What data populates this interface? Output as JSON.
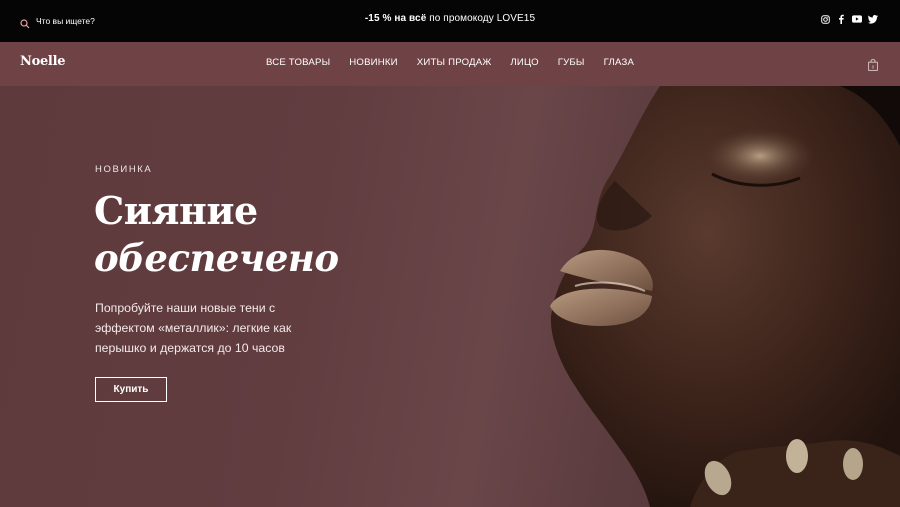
{
  "topbar": {
    "search_placeholder": "Что вы ищете?",
    "promo_bold": "-15 % на всё",
    "promo_rest": " по промокоду LOVE15",
    "social_icons": [
      "instagram-icon",
      "facebook-icon",
      "youtube-icon",
      "twitter-icon"
    ]
  },
  "navbar": {
    "logo": "Noelle",
    "menu": [
      "ВСЕ ТОВАРЫ",
      "НОВИНКИ",
      "ХИТЫ ПРОДАЖ",
      "ЛИЦО",
      "ГУБЫ",
      "ГЛАЗА"
    ],
    "cart_icon": "shopping-bag-icon"
  },
  "hero": {
    "eyebrow": "НОВИНКА",
    "headline_line1": "Сияние",
    "headline_line2": "обеспечено",
    "description": "Попробуйте наши новые тени с эффектом «металлик»: легкие как перышко и держатся до 10 часов",
    "button": "Купить"
  },
  "colors": {
    "topbar_bg": "#050505",
    "navbar_bg": "#6f4346",
    "hero_bg": "#5e3a3c"
  }
}
